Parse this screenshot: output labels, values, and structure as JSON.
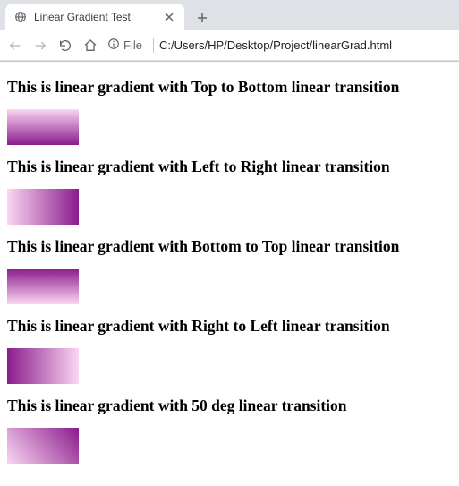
{
  "browser": {
    "tab_title": "Linear Gradient Test",
    "file_label": "File",
    "url": "C:/Users/HP/Desktop/Project/linearGrad.html"
  },
  "content": {
    "headings": [
      "This is linear gradient with Top to Bottom linear transition",
      "This is linear gradient with Left to Right linear transition",
      "This is linear gradient with Bottom to Top linear transition",
      "This is linear gradient with Right to Left linear transition",
      "This is linear gradient with 50 deg linear transition"
    ]
  },
  "colors": {
    "light": "#fbd6f2",
    "dark": "#8a1b8c"
  }
}
